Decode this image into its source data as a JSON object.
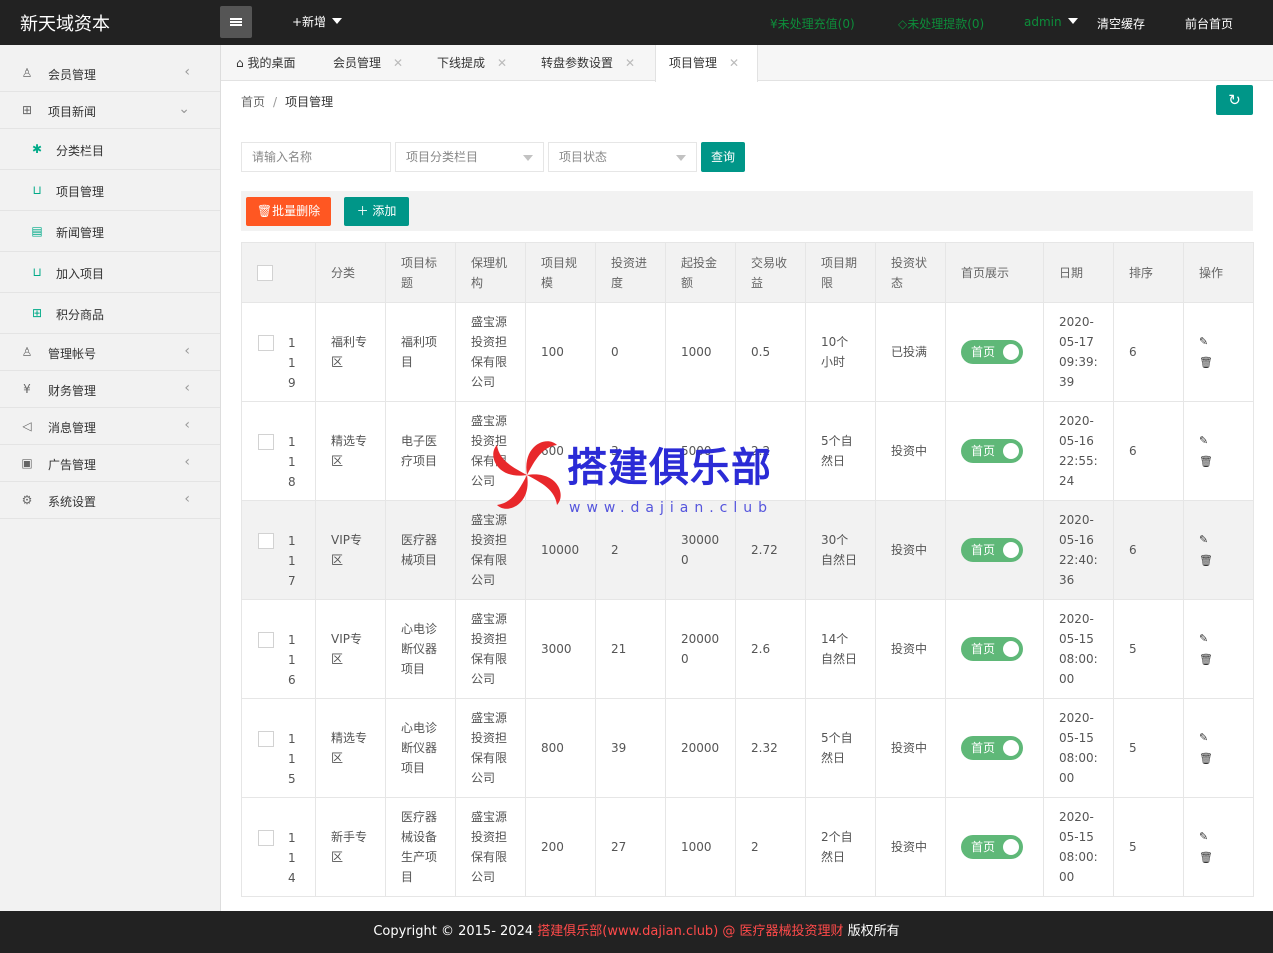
{
  "header": {
    "logo": "新天域资本",
    "new_label": "+新增",
    "recharge": "未处理充值(0)",
    "withdraw": "未处理提款(0)",
    "admin": "admin",
    "clear_cache": "清空缓存",
    "front_home": "前台首页"
  },
  "sidebar": {
    "member": "会员管理",
    "news": "项目新闻",
    "sub_category": "分类栏目",
    "sub_project": "项目管理",
    "sub_news": "新闻管理",
    "sub_join": "加入项目",
    "sub_points": "积分商品",
    "account": "管理帐号",
    "finance": "财务管理",
    "message": "消息管理",
    "ads": "广告管理",
    "system": "系统设置"
  },
  "tabs": {
    "desktop": "我的桌面",
    "member": "会员管理",
    "commission": "下线提成",
    "wheel": "转盘参数设置",
    "project": "项目管理"
  },
  "breadcrumb": {
    "home": "首页",
    "current": "项目管理"
  },
  "filters": {
    "name_placeholder": "请输入名称",
    "category": "项目分类栏目",
    "status": "项目状态",
    "query": "查询"
  },
  "toolbar": {
    "batch_delete": "批量删除",
    "add": "添加"
  },
  "table": {
    "headers": [
      "分类",
      "项目标题",
      "保理机构",
      "项目规模",
      "投资进度",
      "起投金额",
      "交易收益",
      "项目期限",
      "投资状态",
      "首页展示",
      "日期",
      "排序",
      "操作"
    ],
    "switch_label": "首页",
    "rows": [
      {
        "id": "119",
        "cat": "福利专区",
        "title": "福利项目",
        "org": "盛宝源投资担保有限公司",
        "scale": "100",
        "progress": "0",
        "min": "1000",
        "yield": "0.5",
        "term": "10个小时",
        "status": "已投满",
        "date": "2020-05-17 09:39:39",
        "sort": "6"
      },
      {
        "id": "118",
        "cat": "精选专区",
        "title": "电子医疗项目",
        "org": "盛宝源投资担保有限公司",
        "scale": "600",
        "progress": "3",
        "min": "5000",
        "yield": "2.2",
        "term": "5个自然日",
        "status": "投资中",
        "date": "2020-05-16 22:55:24",
        "sort": "6"
      },
      {
        "id": "117",
        "cat": "VIP专区",
        "title": "医疗器械项目",
        "org": "盛宝源投资担保有限公司",
        "scale": "10000",
        "progress": "2",
        "min": "300000",
        "yield": "2.72",
        "term": "30个自然日",
        "status": "投资中",
        "date": "2020-05-16 22:40:36",
        "sort": "6"
      },
      {
        "id": "116",
        "cat": "VIP专区",
        "title": "心电诊断仪器项目",
        "org": "盛宝源投资担保有限公司",
        "scale": "3000",
        "progress": "21",
        "min": "200000",
        "yield": "2.6",
        "term": "14个自然日",
        "status": "投资中",
        "date": "2020-05-15 08:00:00",
        "sort": "5"
      },
      {
        "id": "115",
        "cat": "精选专区",
        "title": "心电诊断仪器项目",
        "org": "盛宝源投资担保有限公司",
        "scale": "800",
        "progress": "39",
        "min": "20000",
        "yield": "2.32",
        "term": "5个自然日",
        "status": "投资中",
        "date": "2020-05-15 08:00:00",
        "sort": "5"
      },
      {
        "id": "114",
        "cat": "新手专区",
        "title": "医疗器械设备生产项目",
        "org": "盛宝源投资担保有限公司",
        "scale": "200",
        "progress": "27",
        "min": "1000",
        "yield": "2",
        "term": "2个自然日",
        "status": "投资中",
        "date": "2020-05-15 08:00:00",
        "sort": "5"
      }
    ]
  },
  "watermark": {
    "text": "搭建俱乐部",
    "url": "www.dajian.club"
  },
  "footer": {
    "prefix": "Copyright © 2015- 2024 ",
    "brand": "搭建俱乐部(www.dajian.club) @ 医疗器械投资理财",
    "suffix": " 版权所有"
  }
}
